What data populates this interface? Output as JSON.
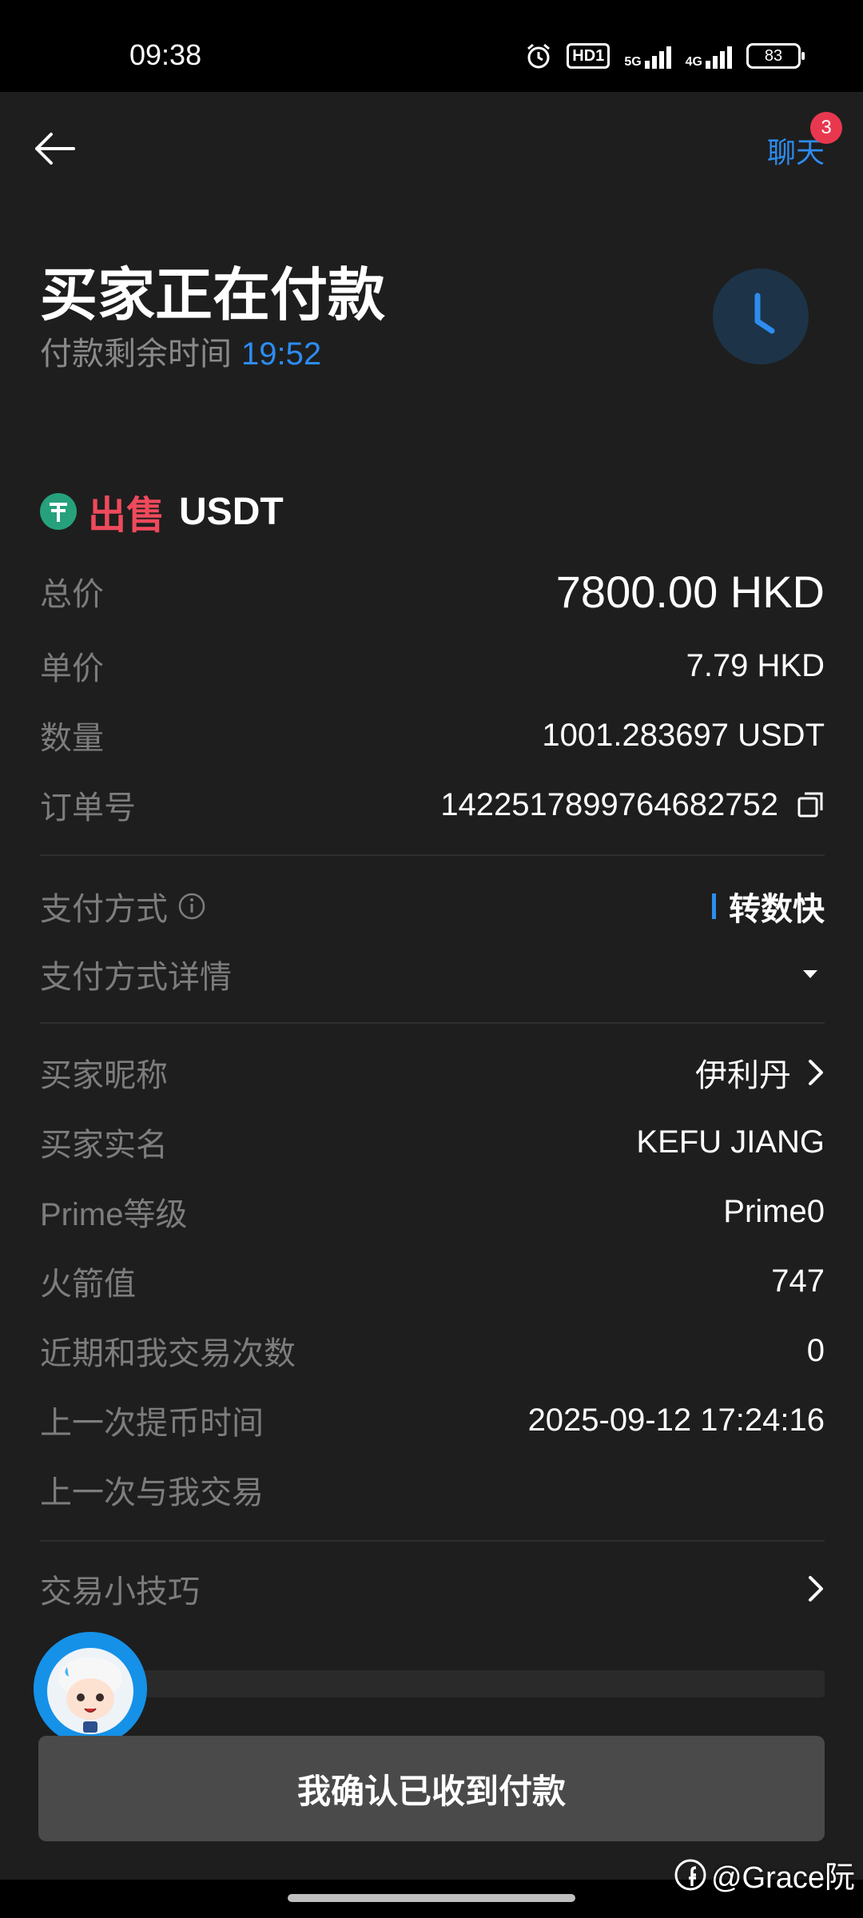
{
  "status_bar": {
    "time": "09:38",
    "hd_label": "HD1",
    "net_5g": "5G",
    "net_4g": "4G",
    "battery": "83",
    "icons": [
      "alarm-icon",
      "hd-icon",
      "signal-5g-icon",
      "signal-4g-icon",
      "battery-icon"
    ]
  },
  "header": {
    "chat_label": "聊天",
    "chat_badge": "3",
    "icons": [
      "back-arrow-icon"
    ]
  },
  "order_status": {
    "title": "买家正在付款",
    "timer_label": "付款剩余时间",
    "timer_value": "19:52",
    "icons": [
      "clock-icon"
    ]
  },
  "asset": {
    "side": "出售",
    "coin": "USDT",
    "icons": [
      "tether-icon"
    ]
  },
  "details": {
    "total_label": "总价",
    "total_value": "7800.00 HKD",
    "unit_price_label": "单价",
    "unit_price_value": "7.79 HKD",
    "quantity_label": "数量",
    "quantity_value": "1001.283697 USDT",
    "order_no_label": "订单号",
    "order_no_value": "1422517899764682752"
  },
  "payment": {
    "method_label": "支付方式",
    "method_value": "转数快",
    "details_label": "支付方式详情"
  },
  "buyer": {
    "nickname_label": "买家昵称",
    "nickname_value": "伊利丹",
    "real_name_label": "买家实名",
    "real_name_value": "KEFU JIANG",
    "prime_label": "Prime等级",
    "prime_value": "Prime0",
    "rocket_label": "火箭值",
    "rocket_value": "747",
    "recent_trades_label": "近期和我交易次数",
    "recent_trades_value": "0",
    "last_withdraw_label": "上一次提币时间",
    "last_withdraw_value": "2025-09-12 17:24:16",
    "last_trade_label": "上一次与我交易"
  },
  "tips": {
    "label": "交易小技巧"
  },
  "actions": {
    "confirm_label": "我确认已收到付款"
  },
  "watermark": {
    "text": "@Grace阮"
  },
  "colors": {
    "accent": "#2d8cf0",
    "sell": "#ef4a5c",
    "badge": "#e8384f",
    "tether": "#26a17b",
    "background": "#1e1e1e"
  }
}
